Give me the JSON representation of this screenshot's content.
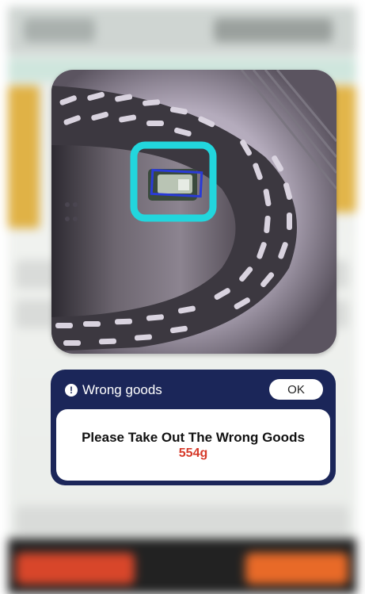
{
  "camera": {
    "image_alt": "Camera view of basket with detected item"
  },
  "alert": {
    "icon": "exclamation-icon",
    "title": "Wrong goods",
    "ok_label": "OK",
    "message": "Please Take Out The Wrong Goods",
    "weight": "554g",
    "colors": {
      "dialog_bg": "#1b2659",
      "weight_text": "#d63a2a",
      "highlight_box": "#22d6dd",
      "detection_box": "#2a3bd6"
    }
  }
}
